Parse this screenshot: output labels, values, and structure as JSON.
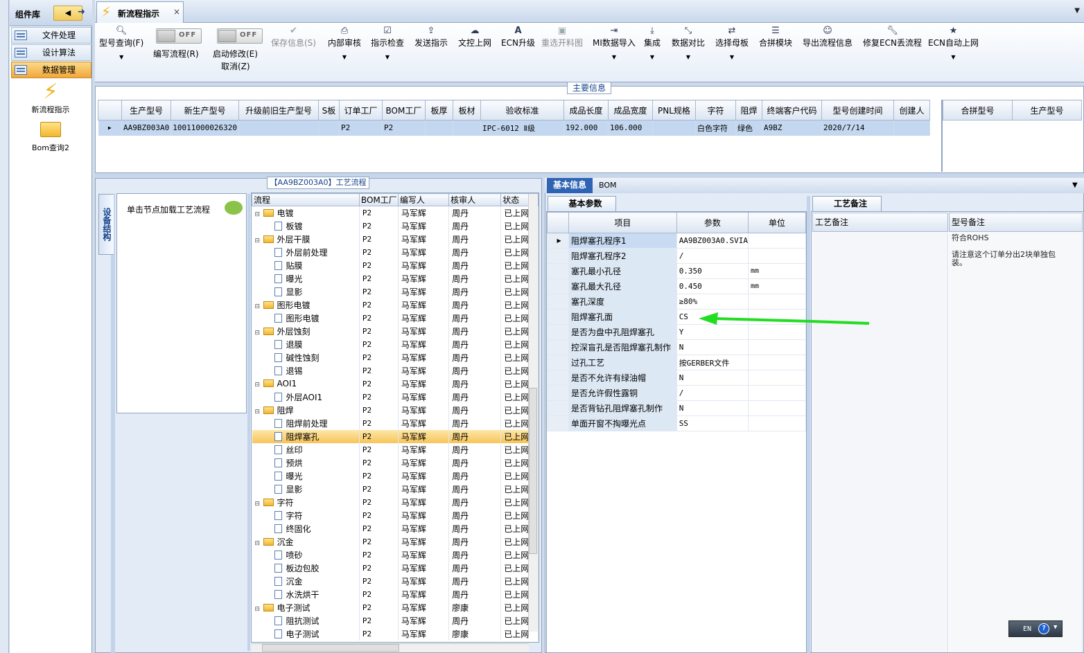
{
  "component_panel": {
    "title": "组件库",
    "collapse_icon": "arrow-left-icon",
    "pin_icon": "sign-in-icon",
    "nav": [
      "文件处理",
      "设计算法",
      "数据管理"
    ],
    "selected_nav": "数据管理",
    "tools": [
      {
        "label": "新流程指示",
        "icon": "lightning-icon"
      },
      {
        "label": "Bom查询2",
        "icon": "folder-open-icon"
      }
    ]
  },
  "doc_tab": {
    "title": "新流程指示",
    "icon": "lightning-icon",
    "close": "×"
  },
  "ribbon": {
    "buttons": [
      {
        "label": "型号查询(F)",
        "icon": "search-icon",
        "dropdown": true,
        "disabled": false
      },
      {
        "label": "保存信息(S)",
        "icon": "check-icon",
        "dropdown": false,
        "disabled": true
      },
      {
        "label": "内部审核",
        "icon": "print-icon",
        "dropdown": true,
        "disabled": false
      },
      {
        "label": "指示检查",
        "icon": "checkbox-icon",
        "dropdown": true,
        "disabled": false
      },
      {
        "label": "发送指示",
        "icon": "upload-icon",
        "dropdown": false,
        "disabled": false
      },
      {
        "label": "文控上网",
        "icon": "cloud-upload-icon",
        "dropdown": false,
        "disabled": false
      },
      {
        "label": "ECN升级",
        "icon": "font-a-icon",
        "dropdown": false,
        "disabled": false
      },
      {
        "label": "重选开料图",
        "icon": "image-icon",
        "dropdown": false,
        "disabled": true
      },
      {
        "label": "MI数据导入",
        "icon": "import-icon",
        "dropdown": true,
        "disabled": false
      },
      {
        "label": "集成",
        "icon": "download-icon",
        "dropdown": true,
        "disabled": false
      },
      {
        "label": "数据对比",
        "icon": "compress-icon",
        "dropdown": true,
        "disabled": false
      },
      {
        "label": "选择母板",
        "icon": "shuffle-icon",
        "dropdown": true,
        "disabled": false
      },
      {
        "label": "合拼模块",
        "icon": "list-icon",
        "dropdown": false,
        "disabled": false
      },
      {
        "label": "导出流程信息",
        "icon": "smile-icon",
        "dropdown": false,
        "disabled": false
      },
      {
        "label": "修复ECN丢流程",
        "icon": "wrench-icon",
        "dropdown": false,
        "disabled": false
      },
      {
        "label": "ECN自动上网",
        "icon": "star-icon",
        "dropdown": true,
        "disabled": false
      }
    ],
    "toggles": [
      {
        "state": "OFF",
        "label": "编写流程(R)"
      },
      {
        "state": "OFF",
        "label": "启动修改(E)",
        "label2": "取消(Z)"
      }
    ]
  },
  "main_info": {
    "title": "主要信息",
    "columns": [
      "生产型号",
      "新生产型号",
      "升级前旧生产型号",
      "S板",
      "订单工厂",
      "BOM工厂",
      "板厚",
      "板材",
      "验收标准",
      "成品长度",
      "成品宽度",
      "PNL规格",
      "字符",
      "阻焊",
      "终端客户代码",
      "型号创建时间",
      "创建人"
    ],
    "rows": [
      [
        "AA9BZ003A0",
        "10011000026320",
        "",
        "",
        "P2",
        "P2",
        "",
        "",
        "IPC-6012 Ⅱ级",
        "192.000",
        "106.000",
        "",
        "白色字符",
        "绿色",
        "A9BZ",
        "2020/7/14",
        ""
      ]
    ],
    "side_columns": [
      "合拼型号",
      "生产型号"
    ]
  },
  "process": {
    "title": "【AA9BZ003A0】工艺流程",
    "vertical_tab": "设备结构",
    "hint": "单击节点加载工艺流程",
    "columns": [
      "流程",
      "BOM工厂",
      "编写人",
      "核审人",
      "状态"
    ],
    "rows": [
      {
        "name": "电镀",
        "folder": true,
        "bom": "P2",
        "writer": "马军辉",
        "auditor": "周丹",
        "status": "已上网"
      },
      {
        "name": "板镀",
        "folder": false,
        "bom": "P2",
        "writer": "马军辉",
        "auditor": "周丹",
        "status": "已上网"
      },
      {
        "name": "外层干膜",
        "folder": true,
        "bom": "P2",
        "writer": "马军辉",
        "auditor": "周丹",
        "status": "已上网"
      },
      {
        "name": "外层前处理",
        "folder": false,
        "bom": "P2",
        "writer": "马军辉",
        "auditor": "周丹",
        "status": "已上网"
      },
      {
        "name": "贴膜",
        "folder": false,
        "bom": "P2",
        "writer": "马军辉",
        "auditor": "周丹",
        "status": "已上网"
      },
      {
        "name": "曝光",
        "folder": false,
        "bom": "P2",
        "writer": "马军辉",
        "auditor": "周丹",
        "status": "已上网"
      },
      {
        "name": "显影",
        "folder": false,
        "bom": "P2",
        "writer": "马军辉",
        "auditor": "周丹",
        "status": "已上网"
      },
      {
        "name": "图形电镀",
        "folder": true,
        "bom": "P2",
        "writer": "马军辉",
        "auditor": "周丹",
        "status": "已上网"
      },
      {
        "name": "图形电镀",
        "folder": false,
        "bom": "P2",
        "writer": "马军辉",
        "auditor": "周丹",
        "status": "已上网"
      },
      {
        "name": "外层蚀刻",
        "folder": true,
        "bom": "P2",
        "writer": "马军辉",
        "auditor": "周丹",
        "status": "已上网"
      },
      {
        "name": "退膜",
        "folder": false,
        "bom": "P2",
        "writer": "马军辉",
        "auditor": "周丹",
        "status": "已上网"
      },
      {
        "name": "碱性蚀刻",
        "folder": false,
        "bom": "P2",
        "writer": "马军辉",
        "auditor": "周丹",
        "status": "已上网"
      },
      {
        "name": "退锡",
        "folder": false,
        "bom": "P2",
        "writer": "马军辉",
        "auditor": "周丹",
        "status": "已上网"
      },
      {
        "name": "AOI1",
        "folder": true,
        "bom": "P2",
        "writer": "马军辉",
        "auditor": "周丹",
        "status": "已上网"
      },
      {
        "name": "外层AOI1",
        "folder": false,
        "bom": "P2",
        "writer": "马军辉",
        "auditor": "周丹",
        "status": "已上网"
      },
      {
        "name": "阻焊",
        "folder": true,
        "bom": "P2",
        "writer": "马军辉",
        "auditor": "周丹",
        "status": "已上网"
      },
      {
        "name": "阻焊前处理",
        "folder": false,
        "bom": "P2",
        "writer": "马军辉",
        "auditor": "周丹",
        "status": "已上网"
      },
      {
        "name": "阻焊塞孔",
        "folder": false,
        "bom": "P2",
        "writer": "马军辉",
        "auditor": "周丹",
        "status": "已上网",
        "selected": true
      },
      {
        "name": "丝印",
        "folder": false,
        "bom": "P2",
        "writer": "马军辉",
        "auditor": "周丹",
        "status": "已上网"
      },
      {
        "name": "预烘",
        "folder": false,
        "bom": "P2",
        "writer": "马军辉",
        "auditor": "周丹",
        "status": "已上网"
      },
      {
        "name": "曝光",
        "folder": false,
        "bom": "P2",
        "writer": "马军辉",
        "auditor": "周丹",
        "status": "已上网"
      },
      {
        "name": "显影",
        "folder": false,
        "bom": "P2",
        "writer": "马军辉",
        "auditor": "周丹",
        "status": "已上网"
      },
      {
        "name": "字符",
        "folder": true,
        "bom": "P2",
        "writer": "马军辉",
        "auditor": "周丹",
        "status": "已上网"
      },
      {
        "name": "字符",
        "folder": false,
        "bom": "P2",
        "writer": "马军辉",
        "auditor": "周丹",
        "status": "已上网"
      },
      {
        "name": "终固化",
        "folder": false,
        "bom": "P2",
        "writer": "马军辉",
        "auditor": "周丹",
        "status": "已上网"
      },
      {
        "name": "沉金",
        "folder": true,
        "bom": "P2",
        "writer": "马军辉",
        "auditor": "周丹",
        "status": "已上网"
      },
      {
        "name": "喷砂",
        "folder": false,
        "bom": "P2",
        "writer": "马军辉",
        "auditor": "周丹",
        "status": "已上网"
      },
      {
        "name": "板边包胶",
        "folder": false,
        "bom": "P2",
        "writer": "马军辉",
        "auditor": "周丹",
        "status": "已上网"
      },
      {
        "name": "沉金",
        "folder": false,
        "bom": "P2",
        "writer": "马军辉",
        "auditor": "周丹",
        "status": "已上网"
      },
      {
        "name": "水洗烘干",
        "folder": false,
        "bom": "P2",
        "writer": "马军辉",
        "auditor": "周丹",
        "status": "已上网"
      },
      {
        "name": "电子测试",
        "folder": true,
        "bom": "P2",
        "writer": "马军辉",
        "auditor": "廖康",
        "status": "已上网"
      },
      {
        "name": "阻抗测试",
        "folder": false,
        "bom": "P2",
        "writer": "马军辉",
        "auditor": "周丹",
        "status": "已上网"
      },
      {
        "name": "电子测试",
        "folder": false,
        "bom": "P2",
        "writer": "马军辉",
        "auditor": "廖康",
        "status": "已上网"
      }
    ]
  },
  "right_panel": {
    "tabs": [
      "基本信息",
      "BOM"
    ],
    "active_tab": "基本信息",
    "params_tab": "基本参数",
    "param_columns": [
      "项目",
      "参数",
      "单位"
    ],
    "params": [
      {
        "item": "阻焊塞孔程序1",
        "value": "AA9BZ003A0.SVIA",
        "unit": ""
      },
      {
        "item": "阻焊塞孔程序2",
        "value": "/",
        "unit": ""
      },
      {
        "item": "塞孔最小孔径",
        "value": "0.350",
        "unit": "mm"
      },
      {
        "item": "塞孔最大孔径",
        "value": "0.450",
        "unit": "mm"
      },
      {
        "item": "塞孔深度",
        "value": "≥80%",
        "unit": ""
      },
      {
        "item": "阻焊塞孔面",
        "value": "CS",
        "unit": ""
      },
      {
        "item": "是否为盘中孔阻焊塞孔",
        "value": "Y",
        "unit": ""
      },
      {
        "item": "控深盲孔是否阻焊塞孔制作",
        "value": "N",
        "unit": ""
      },
      {
        "item": "过孔工艺",
        "value": "按GERBER文件",
        "unit": ""
      },
      {
        "item": "是否不允许有绿油帽",
        "value": "N",
        "unit": ""
      },
      {
        "item": "是否允许假性露铜",
        "value": "/",
        "unit": ""
      },
      {
        "item": "是否背钻孔阻焊塞孔制作",
        "value": "N",
        "unit": ""
      },
      {
        "item": "单面开窗不掏曝光点",
        "value": "SS",
        "unit": ""
      }
    ],
    "remarks_tab": "工艺备注",
    "remark_columns": [
      "工艺备注",
      "型号备注"
    ],
    "model_remark": "符合ROHS\n\n请注意这个订单分出2块单独包装。",
    "annotation_color": "#22dd22"
  },
  "ime": {
    "lang": "EN",
    "help": "?"
  }
}
